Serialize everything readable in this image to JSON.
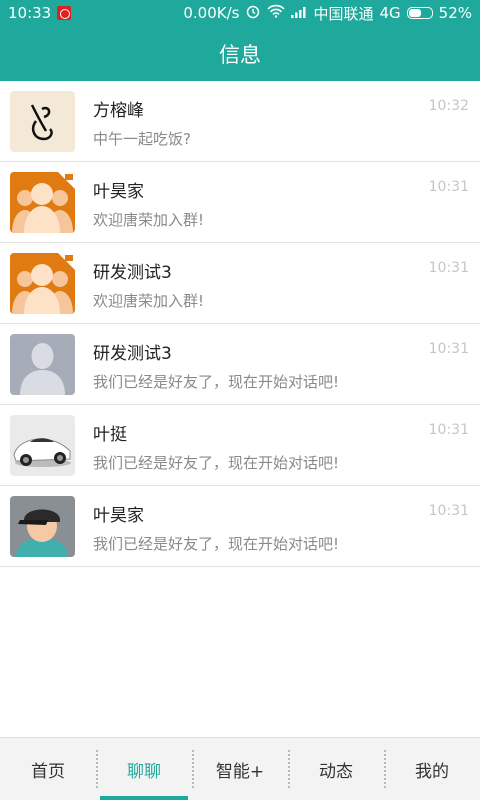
{
  "status": {
    "time": "10:33",
    "speed": "0.00K/s",
    "carrier": "中国联通",
    "network": "4G",
    "battery": "52%",
    "battery_level": 0.52
  },
  "header": {
    "title": "信息"
  },
  "conversations": [
    {
      "name": "方榕峰",
      "message": "中午一起吃饭?",
      "time": "10:32",
      "avatar": "calligraphy-avatar"
    },
    {
      "name": "叶昊家",
      "message": "欢迎唐荣加入群!",
      "time": "10:31",
      "avatar": "group-avatar"
    },
    {
      "name": "研发测试3",
      "message": "欢迎唐荣加入群!",
      "time": "10:31",
      "avatar": "group-avatar"
    },
    {
      "name": "研发测试3",
      "message": "我们已经是好友了，现在开始对话吧!",
      "time": "10:31",
      "avatar": "default-person-avatar"
    },
    {
      "name": "叶挺",
      "message": "我们已经是好友了，现在开始对话吧!",
      "time": "10:31",
      "avatar": "sports-car-avatar"
    },
    {
      "name": "叶昊家",
      "message": "我们已经是好友了，现在开始对话吧!",
      "time": "10:31",
      "avatar": "cap-person-avatar"
    }
  ],
  "tabs": [
    {
      "label": "首页",
      "active": false
    },
    {
      "label": "聊聊",
      "active": true
    },
    {
      "label": "智能+",
      "active": false
    },
    {
      "label": "动态",
      "active": false
    },
    {
      "label": "我的",
      "active": false
    }
  ],
  "colors": {
    "accent": "#1fa99c",
    "group_avatar": "#e07b12"
  }
}
